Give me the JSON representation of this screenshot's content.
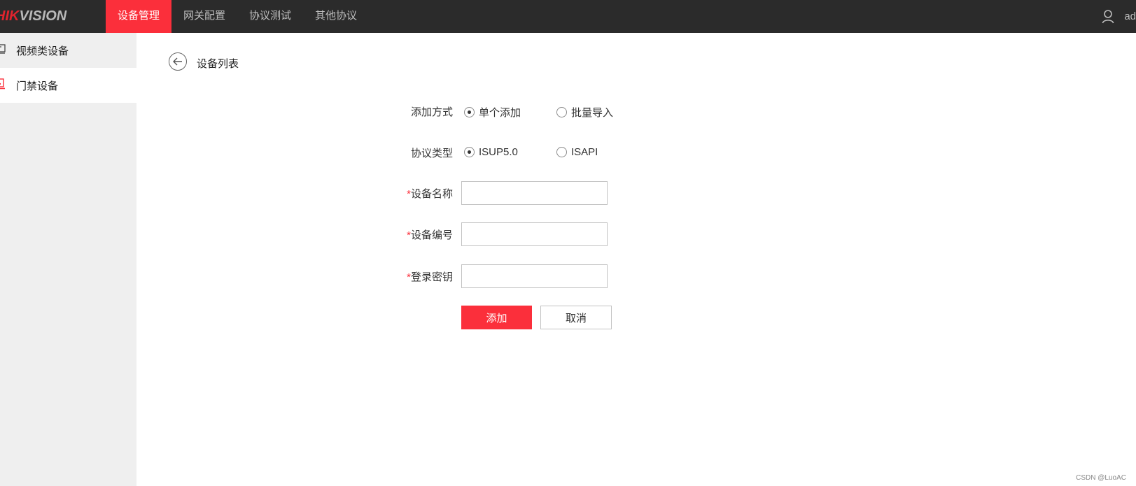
{
  "header": {
    "logo_red": "HIK",
    "logo_gray": "VISION",
    "nav": [
      {
        "label": "设备管理",
        "active": true
      },
      {
        "label": "网关配置",
        "active": false
      },
      {
        "label": "协议测试",
        "active": false
      },
      {
        "label": "其他协议",
        "active": false
      }
    ],
    "user_name": "ad"
  },
  "sidebar": {
    "items": [
      {
        "label": "视频类设备",
        "icon": "monitor-icon",
        "active": false
      },
      {
        "label": "门禁设备",
        "icon": "door-access-icon",
        "active": true
      }
    ]
  },
  "page": {
    "title": "设备列表"
  },
  "form": {
    "add_method": {
      "label": "添加方式",
      "options": [
        {
          "label": "单个添加",
          "checked": true
        },
        {
          "label": "批量导入",
          "checked": false
        }
      ]
    },
    "protocol_type": {
      "label": "协议类型",
      "options": [
        {
          "label": "ISUP5.0",
          "checked": true
        },
        {
          "label": "ISAPI",
          "checked": false
        }
      ]
    },
    "required_mark": "*",
    "device_name": {
      "label": "设备名称",
      "value": ""
    },
    "device_number": {
      "label": "设备编号",
      "value": ""
    },
    "login_key": {
      "label": "登录密钥",
      "value": ""
    },
    "add_button": "添加",
    "cancel_button": "取消"
  },
  "watermark": "CSDN @LuoAC",
  "colors": {
    "accent": "#fb2f3b",
    "topbar": "#2b2b2b",
    "sidebar": "#efefef"
  }
}
